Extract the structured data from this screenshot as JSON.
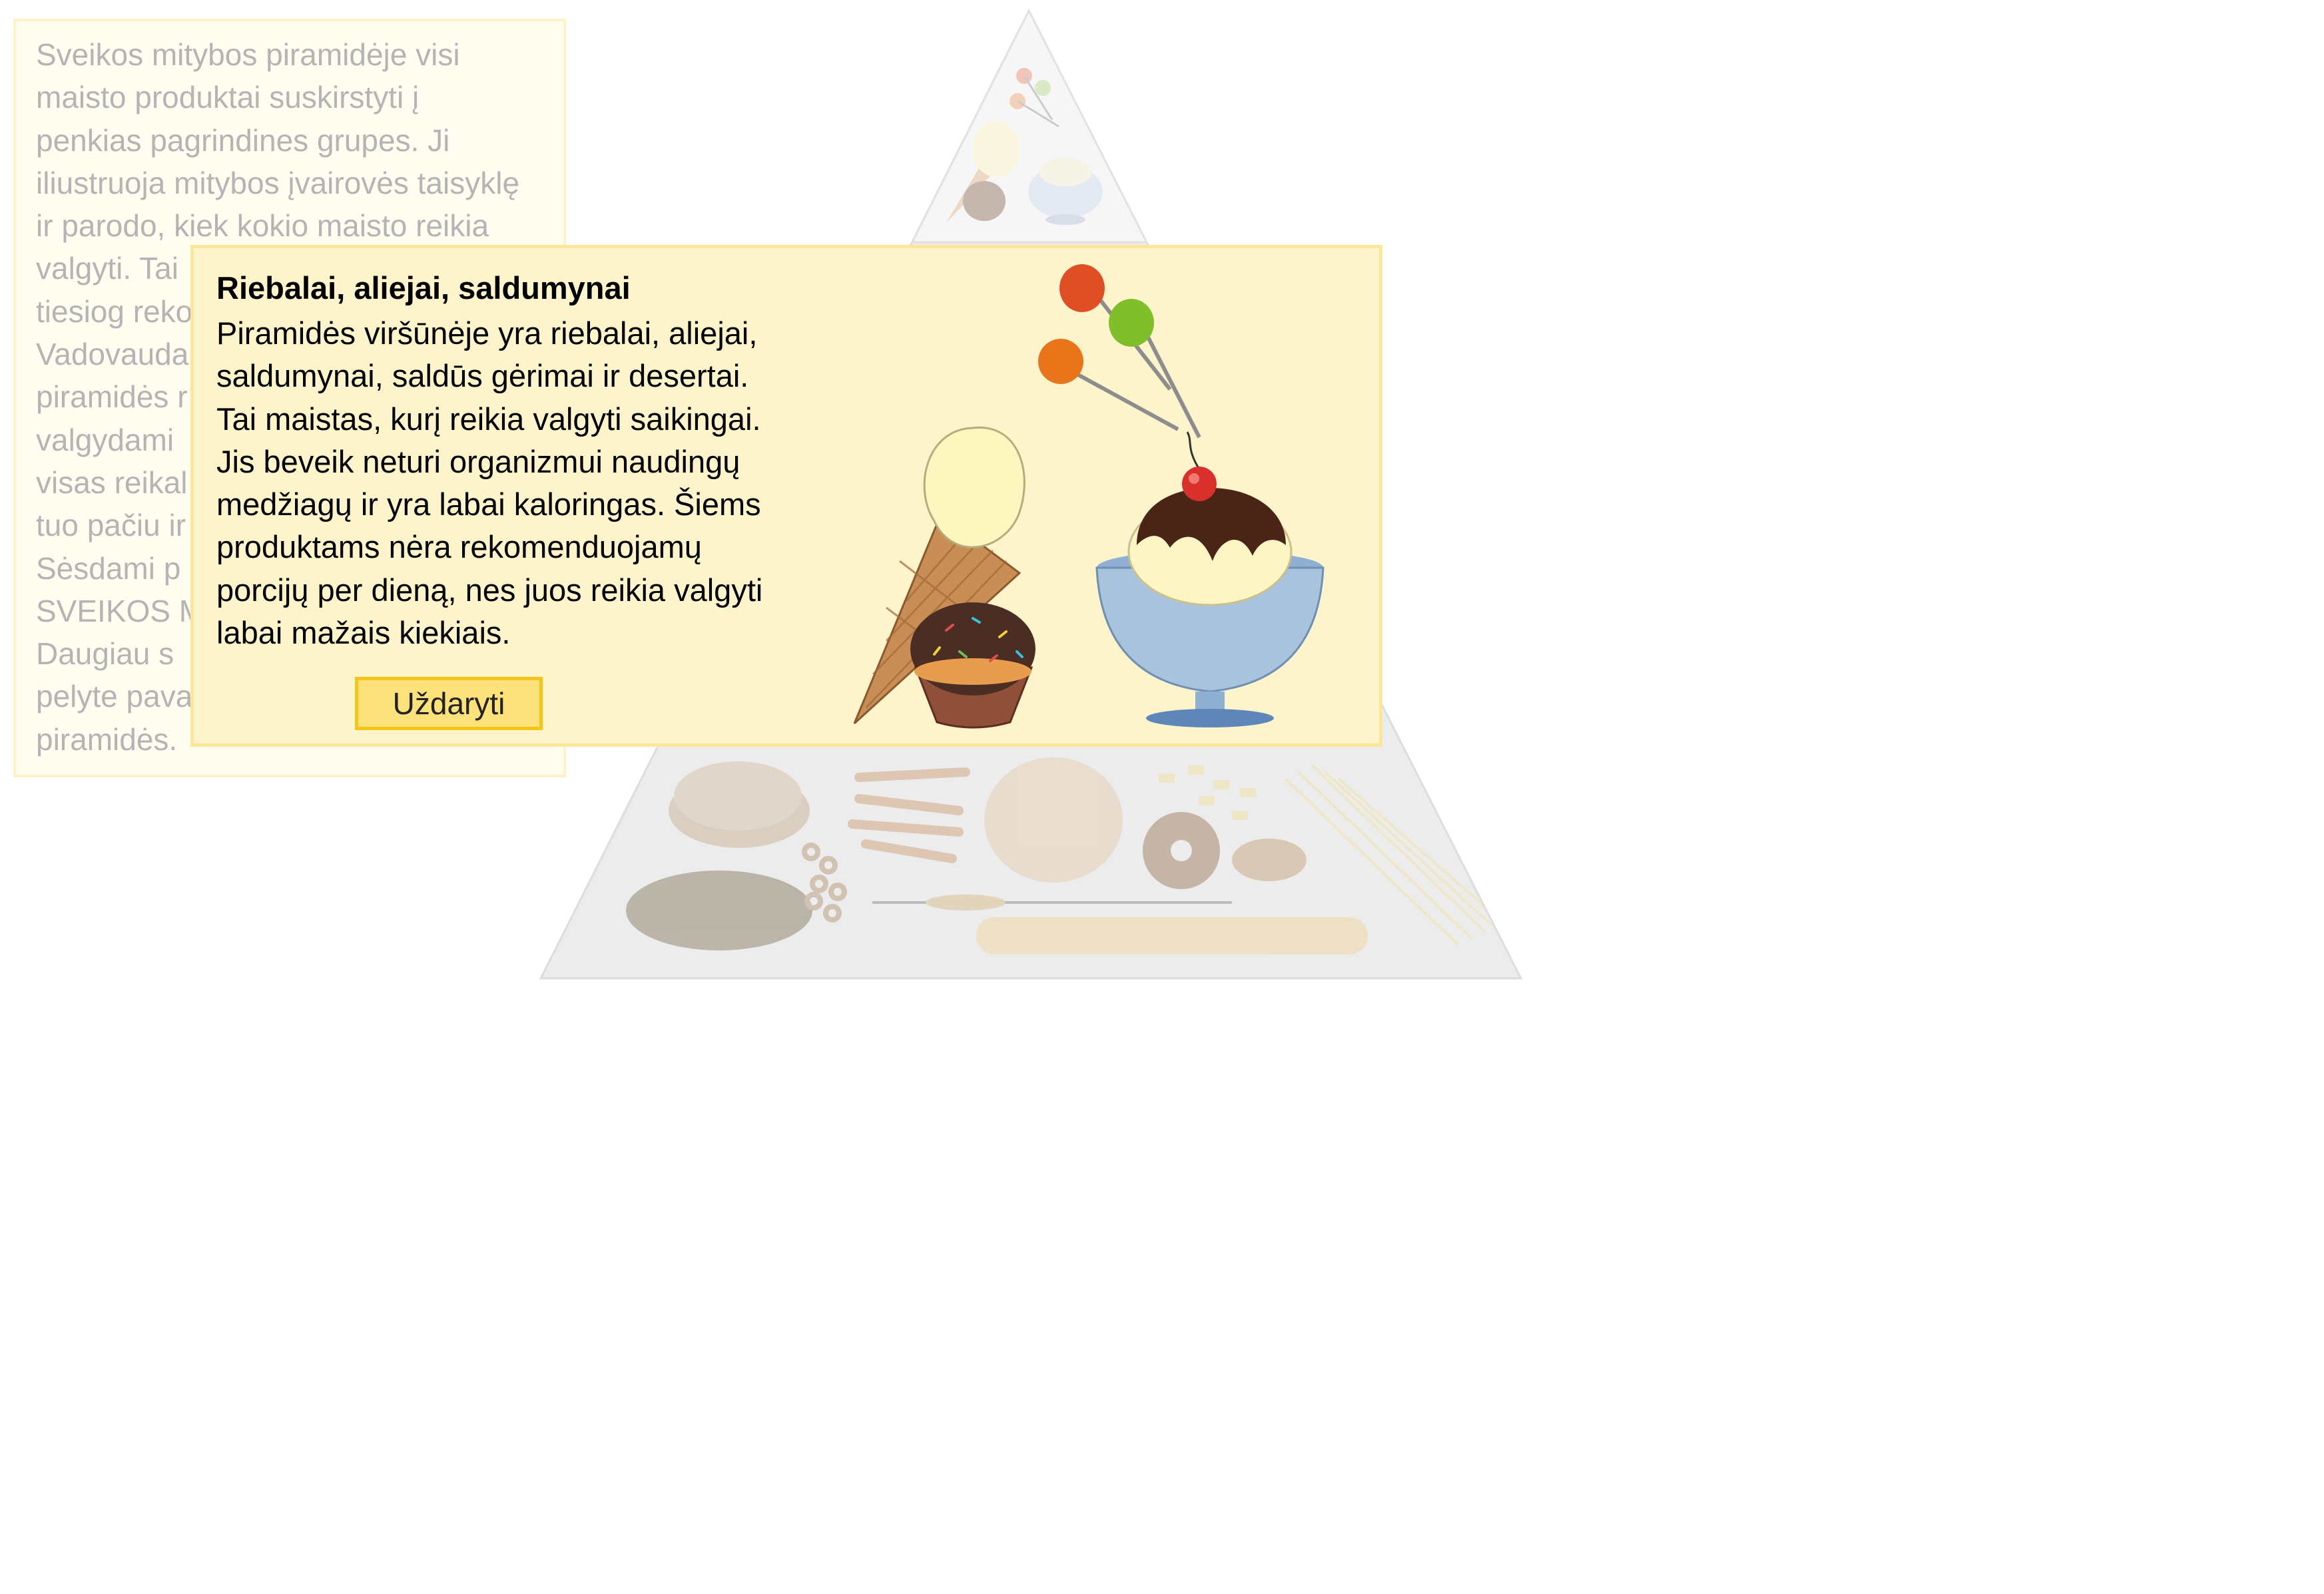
{
  "intro": {
    "text": "Sveikos mitybos piramidėje visi\nmaisto produktai suskirstyti į\npenkias pagrindines grupes. Ji\niliustruoja mitybos įvairovės taisyklę\nir parodo, kiek kokio maisto reikia\nvalgyti. Tai\ntiesiog reko\nVadovauda\npiramidės r\nvalgydami\nvisas reikal\ntuo pačiu ir\nSėsdami p\nSVEIKOS M\nDaugiau  s\npelyte pava\npiramidės."
  },
  "popup": {
    "title": "Riebalai, aliejai, saldumynai",
    "body": "Piramidės viršūnėje yra riebalai, aliejai,\nsaldumynai, saldūs gėrimai ir desertai.\nTai maistas, kurį reikia valgyti saikingai.\nJis beveik neturi organizmui naudingų\nmedžiagų ir yra labai kaloringas. Šiems\nproduktams nėra rekomenduojamų\nporcijų per dieną, nes juos reikia valgyti\nlabai mažais kiekiais.",
    "close_label": "Uždaryti"
  },
  "colors": {
    "popup_bg": "#fdf4cc",
    "popup_border": "#fbe69a",
    "button_bg": "#fde17a",
    "button_border": "#f5c518",
    "faded_text": "#b4b4b4",
    "pyramid_fill": "#ececec"
  },
  "icons": {
    "pyramid": "food-pyramid-icon",
    "lollipops": "lollipop-icon",
    "ice_cream_cone": "ice-cream-cone-icon",
    "muffin": "muffin-icon",
    "sundae": "sundae-icon"
  }
}
